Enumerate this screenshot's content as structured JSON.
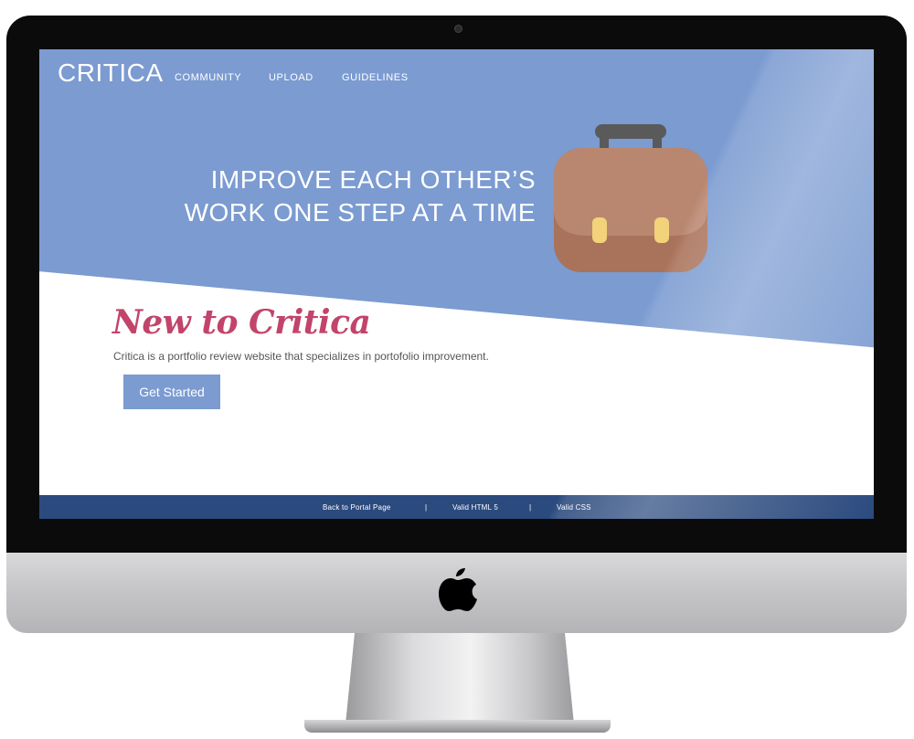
{
  "site": {
    "logo": "CRITICA",
    "nav": [
      {
        "label": "COMMUNITY"
      },
      {
        "label": "UPLOAD"
      },
      {
        "label": "GUIDELINES"
      }
    ]
  },
  "hero": {
    "headline_line1": "IMPROVE EACH OTHER’S",
    "headline_line2": "WORK ONE STEP AT A TIME",
    "icon": "briefcase-illustration"
  },
  "welcome": {
    "title": "New to Critica",
    "description": "Critica is a portfolio review website that specializes in portofolio improvement.",
    "cta_label": "Get Started"
  },
  "footer": {
    "links": [
      {
        "label": "Back to Portal Page"
      },
      {
        "label": "Valid HTML 5"
      },
      {
        "label": "Valid CSS"
      }
    ],
    "separator": "|"
  },
  "colors": {
    "hero_blue": "#7b9bd1",
    "title_pink": "#c2446b",
    "footer_navy": "#2b4a7e",
    "briefcase_brown": "#a9725a"
  }
}
